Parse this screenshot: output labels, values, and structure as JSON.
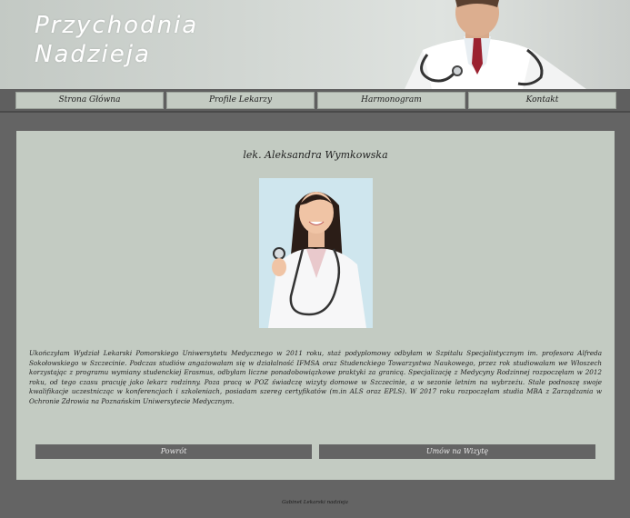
{
  "header": {
    "brand_line1": "Przychodnia",
    "brand_line2": "Nadzieja"
  },
  "nav": {
    "items": [
      {
        "label": "Strona Główna"
      },
      {
        "label": "Profile Lekarzy"
      },
      {
        "label": "Harmonogram"
      },
      {
        "label": "Kontakt"
      }
    ]
  },
  "profile": {
    "name": "lek. Aleksandra Wymkowska",
    "bio": "Ukończyłam Wydział Lekarski Pomorskiego Uniwersytetu Medycznego w 2011 roku, staż podyplomowy odbyłam w Szpitalu Specjalistycznym im. profesora Alfreda Sokołowskiego w Szczecinie. Podczas studiów angażowałam się w działalność IFMSA oraz Studenckiego Towarzystwa Naukowego, przez rok studiowałam we Włoszech korzystając z programu wymiany studenckiej Erasmus, odbyłam liczne ponadobowiązkowe praktyki za granicą. Specjalizację z Medycyny Rodzinnej rozpoczęłam w 2012 roku, od tego czasu pracuję jako lekarz rodzinny. Poza pracą w POZ świadczę wizyty domowe w Szczecinie, a w sezonie letnim na wybrzeżu. Stale podnoszę swoje kwalifikacje uczestnicząc w konferencjach i szkoleniach, posiadam szereg certyfikatów (m.in ALS oraz EPLS). W 2017 roku rozpoczęłam studia MBA z Zarządzania w Ochronie Zdrowia na Poznańskim Uniwersytecie Medycznym."
  },
  "buttons": {
    "back": "Powrót",
    "book": "Umów na Wizytę"
  },
  "footer": {
    "text": "Gabinet Lekarski nadzieja"
  }
}
